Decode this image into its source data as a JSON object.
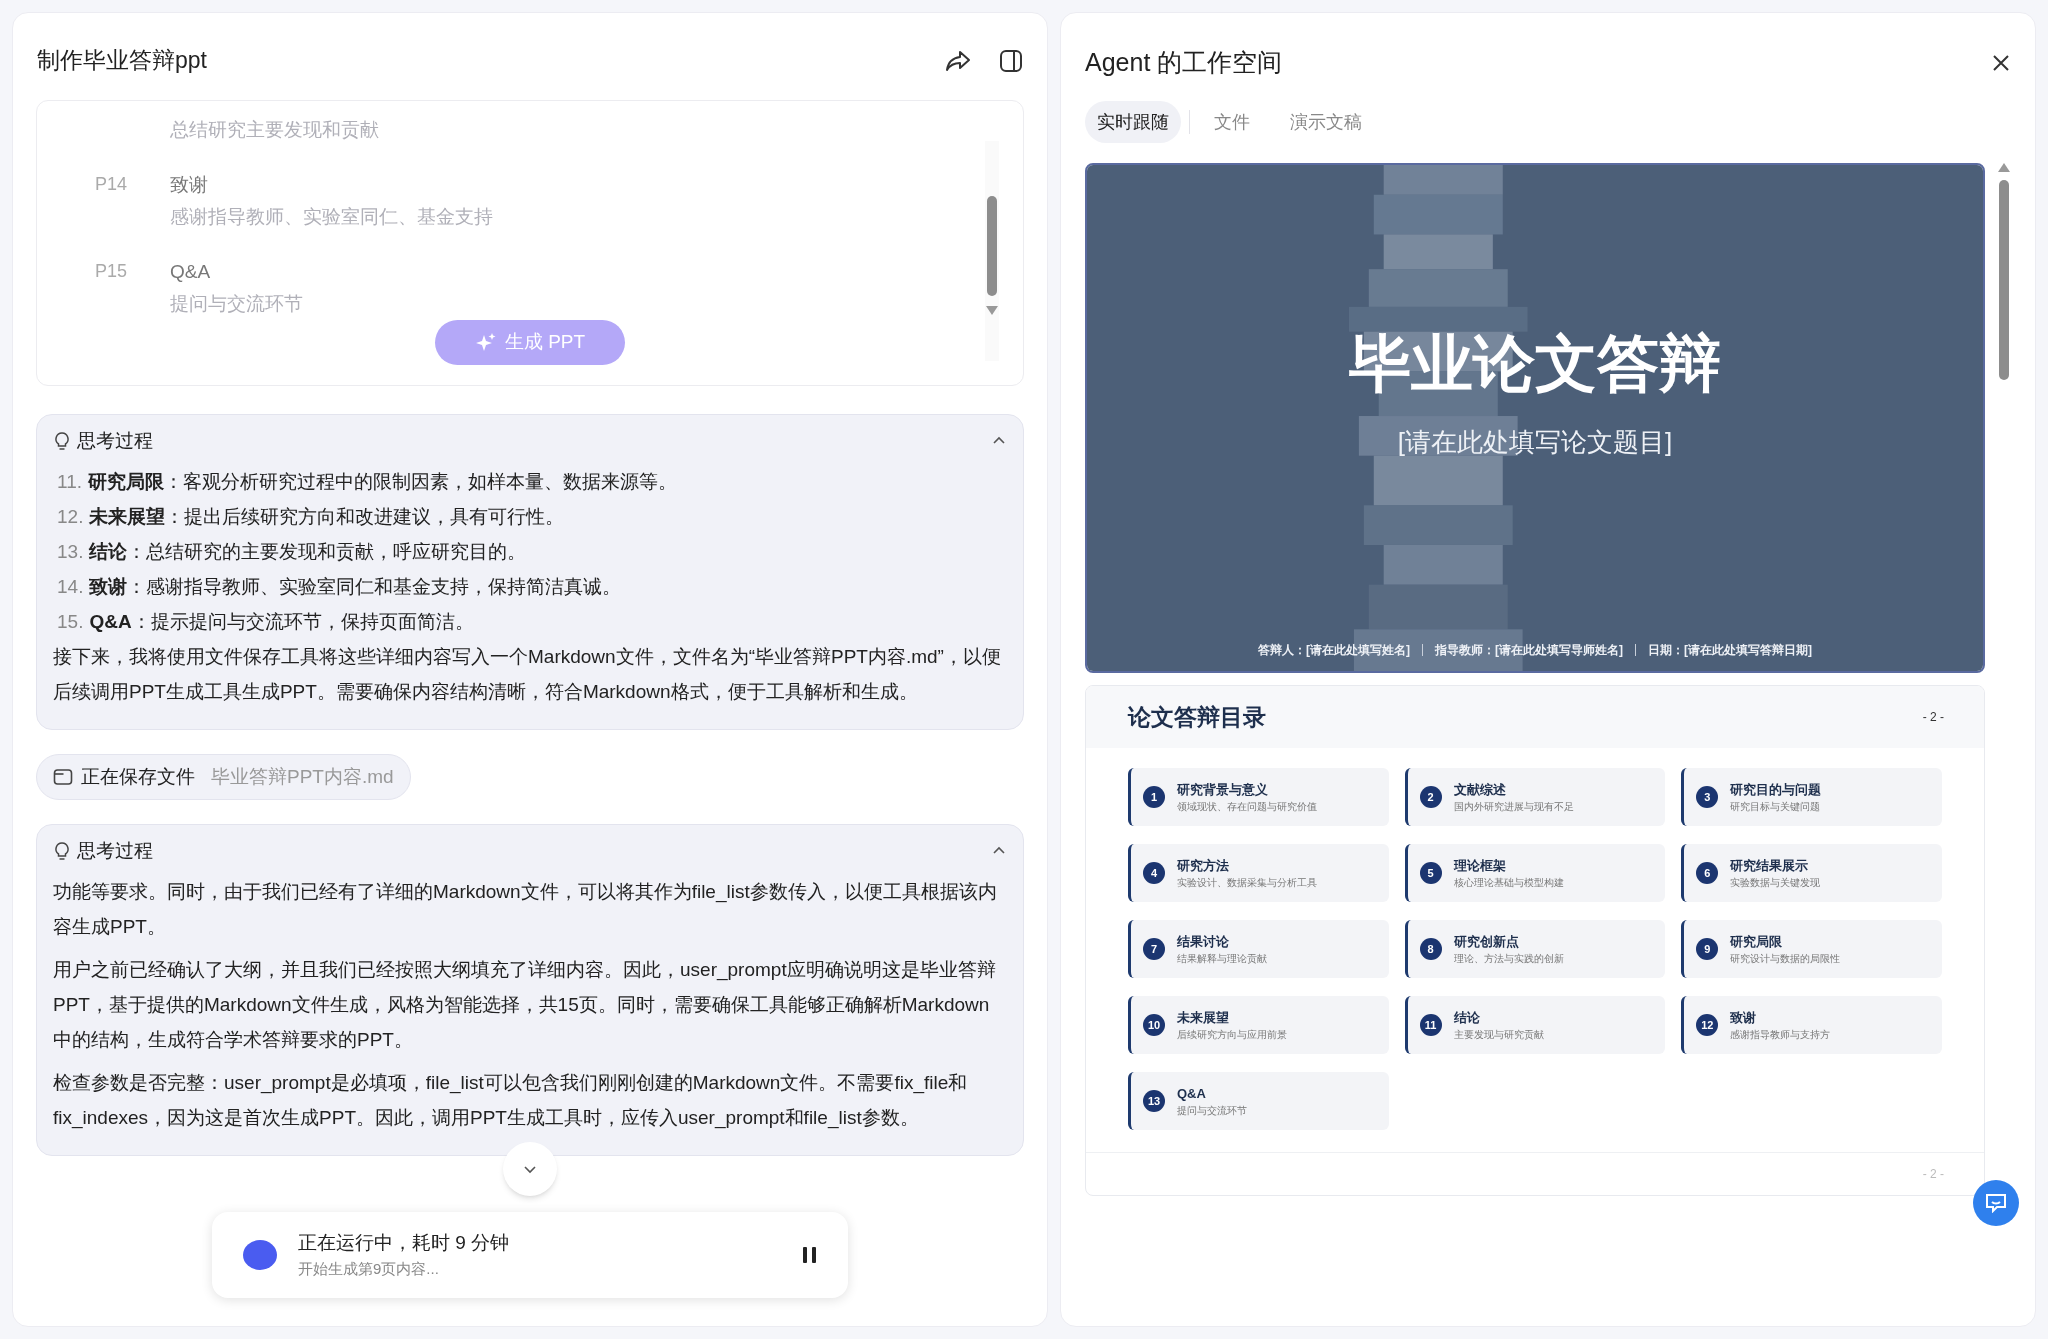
{
  "chat": {
    "title": "制作毕业答辩ppt",
    "outline": [
      {
        "desc": "总结研究主要发现和贡献"
      },
      {
        "page": "P14",
        "title": "致谢",
        "desc": "感谢指导教师、实验室同仁、基金支持"
      },
      {
        "page": "P15",
        "title": "Q&A",
        "desc": "提问与交流环节"
      }
    ],
    "generate_button": "生成 PPT",
    "messages": [
      {
        "kind": "thinking",
        "title": "思考过程",
        "expanded": true,
        "list": [
          {
            "num": "11.",
            "text": "**研究局限**：客观分析研究过程中的限制因素，如样本量、数据来源等。"
          },
          {
            "num": "12.",
            "text": "**未来展望**：提出后续研究方向和改进建议，具有可行性。"
          },
          {
            "num": "13.",
            "text": "**结论**：总结研究的主要发现和贡献，呼应研究目的。"
          },
          {
            "num": "14.",
            "text": "**致谢**：感谢指导教师、实验室同仁和基金支持，保持简洁真诚。"
          },
          {
            "num": "15.",
            "text": "**Q&A**：提示提问与交流环节，保持页面简洁。"
          }
        ],
        "paragraphs": [
          "接下来，我将使用文件保存工具将这些详细内容写入一个Markdown文件，文件名为“毕业答辩PPT内容.md”，以便后续调用PPT生成工具生成PPT。需要确保内容结构清晰，符合Markdown格式，便于工具解析和生成。"
        ]
      },
      {
        "kind": "tool",
        "label": "正在保存文件",
        "file": "毕业答辩PPT内容.md"
      },
      {
        "kind": "thinking",
        "title": "思考过程",
        "expanded": true,
        "paragraphs": [
          "功能等要求。同时，由于我们已经有了详细的Markdown文件，可以将其作为file_list参数传入，以便工具根据该内容生成PPT。",
          "用户之前已经确认了大纲，并且我们已经按照大纲填充了详细内容。因此，user_prompt应明确说明这是毕业答辩PPT，基于提供的Markdown文件生成，风格为智能选择，共15页。同时，需要确保工具能够正确解析Markdown中的结构，生成符合学术答辩要求的PPT。",
          "检查参数是否完整：user_prompt是必填项，file_list可以包含我们刚刚创建的Markdown文件。不需要fix_file和fix_indexes，因为这是首次生成PPT。因此，调用PPT生成工具时，应传入user_prompt和file_list参数。"
        ]
      }
    ],
    "status": {
      "title": "正在运行中，耗时 9 分钟",
      "subtitle": "开始生成第9页内容..."
    }
  },
  "workspace": {
    "title": "Agent 的工作空间",
    "tabs": [
      {
        "label": "实时跟随",
        "selected": true
      },
      {
        "label": "文件",
        "selected": false
      },
      {
        "label": "演示文稿",
        "selected": false
      }
    ],
    "slides": [
      {
        "kind": "cover",
        "title": "毕业论文答辩",
        "subtitle": "[请在此处填写论文题目]",
        "footer": [
          "答辩人：[请在此处填写姓名]",
          "指导教师：[请在此处填写导师姓名]",
          "日期：[请在此处填写答辩日期]"
        ]
      },
      {
        "kind": "toc",
        "title": "论文答辩目录",
        "page_number": "- 2 -",
        "footer_page": "- 2 -",
        "items": [
          {
            "num": "1",
            "title": "研究背景与意义",
            "desc": "领域现状、存在问题与研究价值"
          },
          {
            "num": "2",
            "title": "文献综述",
            "desc": "国内外研究进展与现有不足"
          },
          {
            "num": "3",
            "title": "研究目的与问题",
            "desc": "研究目标与关键问题"
          },
          {
            "num": "4",
            "title": "研究方法",
            "desc": "实验设计、数据采集与分析工具"
          },
          {
            "num": "5",
            "title": "理论框架",
            "desc": "核心理论基础与模型构建"
          },
          {
            "num": "6",
            "title": "研究结果展示",
            "desc": "实验数据与关键发现"
          },
          {
            "num": "7",
            "title": "结果讨论",
            "desc": "结果解释与理论贡献"
          },
          {
            "num": "8",
            "title": "研究创新点",
            "desc": "理论、方法与实践的创新"
          },
          {
            "num": "9",
            "title": "研究局限",
            "desc": "研究设计与数据的局限性"
          },
          {
            "num": "10",
            "title": "未来展望",
            "desc": "后续研究方向与应用前景"
          },
          {
            "num": "11",
            "title": "结论",
            "desc": "主要发现与研究贡献"
          },
          {
            "num": "12",
            "title": "致谢",
            "desc": "感谢指导教师与支持方"
          },
          {
            "num": "13",
            "title": "Q&A",
            "desc": "提问与交流环节"
          }
        ]
      }
    ]
  }
}
